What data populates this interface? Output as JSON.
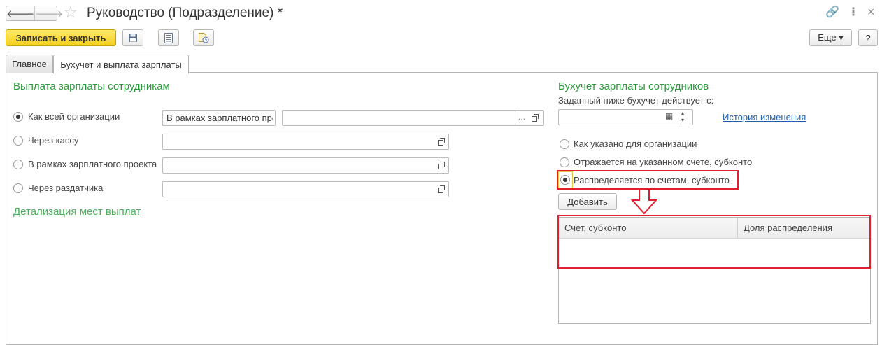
{
  "window": {
    "title": "Руководство (Подразделение) *",
    "back_glyph": "🡐",
    "forward_glyph": "🡒",
    "star_glyph": "☆",
    "link_glyph": "🔗",
    "menu_glyph": "⋮",
    "close_glyph": "×"
  },
  "toolbar": {
    "save_close_label": "Записать и закрыть",
    "more_label": "Еще ▾",
    "help_label": "?"
  },
  "tabs": [
    {
      "label": "Главное"
    },
    {
      "label": "Бухучет и выплата зарплаты"
    }
  ],
  "payment": {
    "title": "Выплата зарплаты сотрудникам",
    "options": [
      {
        "label": "Как всей организации",
        "checked": true
      },
      {
        "label": "Через кассу",
        "checked": false
      },
      {
        "label": "В рамках зарплатного проекта",
        "checked": false
      },
      {
        "label": "Через раздатчика",
        "checked": false
      }
    ],
    "org_mode_value": "В рамках зарплатного про",
    "details_link": "Детализация мест выплат",
    "ellipsis": "..."
  },
  "accounting": {
    "title": "Бухучет зарплаты сотрудников",
    "date_label": "Заданный ниже бухучет действует с:",
    "history_link": "История изменения",
    "calendar_glyph": "▦",
    "options": [
      {
        "label": "Как указано для организации",
        "checked": false
      },
      {
        "label": "Отражается на указанном счете, субконто",
        "checked": false
      },
      {
        "label": "Распределяется по счетам, субконто",
        "checked": true
      }
    ],
    "add_label": "Добавить",
    "columns": [
      "Счет, субконто",
      "Доля распределения"
    ]
  },
  "colors": {
    "accent_green": "#2a9a3c",
    "highlight_red": "#e0202e",
    "primary_yellow": "#f4cf1c"
  }
}
